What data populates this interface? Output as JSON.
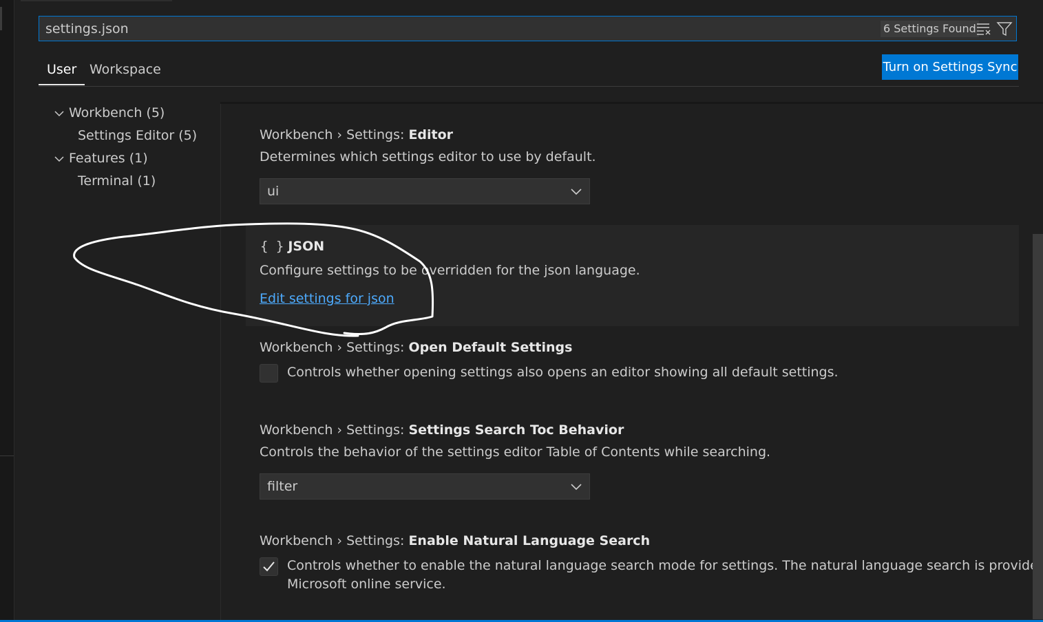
{
  "search": {
    "value": "settings.json",
    "results_label": "6 Settings Found",
    "clear_filter_icon": "clear-filter-icon",
    "filter_icon": "filter-icon"
  },
  "tabs": [
    {
      "label": "User",
      "active": true
    },
    {
      "label": "Workspace",
      "active": false
    }
  ],
  "sync_button": {
    "label": "Turn on Settings Sync"
  },
  "toc": [
    {
      "label": "Workbench (5)",
      "expanded": true
    },
    {
      "label": "Settings Editor (5)"
    },
    {
      "label": "Features (1)",
      "expanded": true
    },
    {
      "label": "Terminal (1)"
    }
  ],
  "settings": [
    {
      "category": "Workbench › Settings: ",
      "key": "Editor",
      "description": "Determines which settings editor to use by default.",
      "control": "select",
      "value": "ui"
    },
    {
      "icon": "json-braces-icon",
      "braces": "{ }",
      "title": "JSON",
      "description": "Configure settings to be overridden for the json language.",
      "link": "Edit settings for json"
    },
    {
      "category": "Workbench › Settings: ",
      "key": "Open Default Settings",
      "control": "checkbox",
      "checked": false,
      "description": "Controls whether opening settings also opens an editor showing all default settings."
    },
    {
      "category": "Workbench › Settings: ",
      "key": "Settings Search Toc Behavior",
      "description": "Controls the behavior of the settings editor Table of Contents while searching.",
      "control": "select",
      "value": "filter"
    },
    {
      "category": "Workbench › Settings: ",
      "key": "Enable Natural Language Search",
      "control": "checkbox",
      "checked": true,
      "description_line1": "Controls whether to enable the natural language search mode for settings. The natural language search is provided by a",
      "description_line2": "Microsoft online service."
    }
  ],
  "colors": {
    "accent": "#0078d4",
    "link": "#4daafc",
    "background": "#1f1f1f",
    "annotation": "#ffffff"
  }
}
